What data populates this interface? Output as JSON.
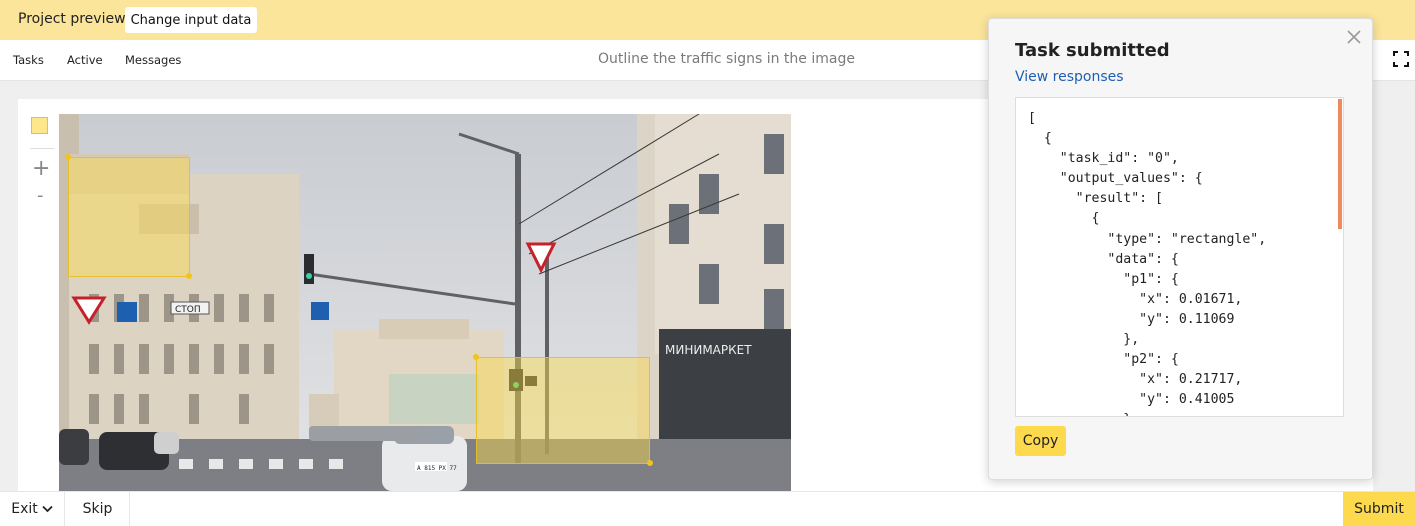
{
  "header": {
    "title": "Project preview",
    "change_input_label": "Change input data"
  },
  "nav": {
    "tasks": "Tasks",
    "active": "Active",
    "messages": "Messages",
    "instruction": "Outline the traffic signs in the image"
  },
  "photo": {
    "sign_text": "СТОП",
    "store_text": "МИНИМАРКЕТ",
    "plate_text": "А 815 РХ 77"
  },
  "footer": {
    "exit_label": "Exit",
    "skip_label": "Skip",
    "submit_label": "Submit"
  },
  "modal": {
    "title": "Task submitted",
    "link": "View responses",
    "json_text": "[\n  {\n    \"task_id\": \"0\",\n    \"output_values\": {\n      \"result\": [\n        {\n          \"type\": \"rectangle\",\n          \"data\": {\n            \"p1\": {\n              \"x\": 0.01671,\n              \"y\": 0.11069\n            },\n            \"p2\": {\n              \"x\": 0.21717,\n              \"y\": 0.41005\n            }",
    "copy_label": "Copy"
  },
  "colors": {
    "accent": "#fcd94d",
    "topbar": "#fbe59b",
    "link": "#1e5fb3"
  }
}
